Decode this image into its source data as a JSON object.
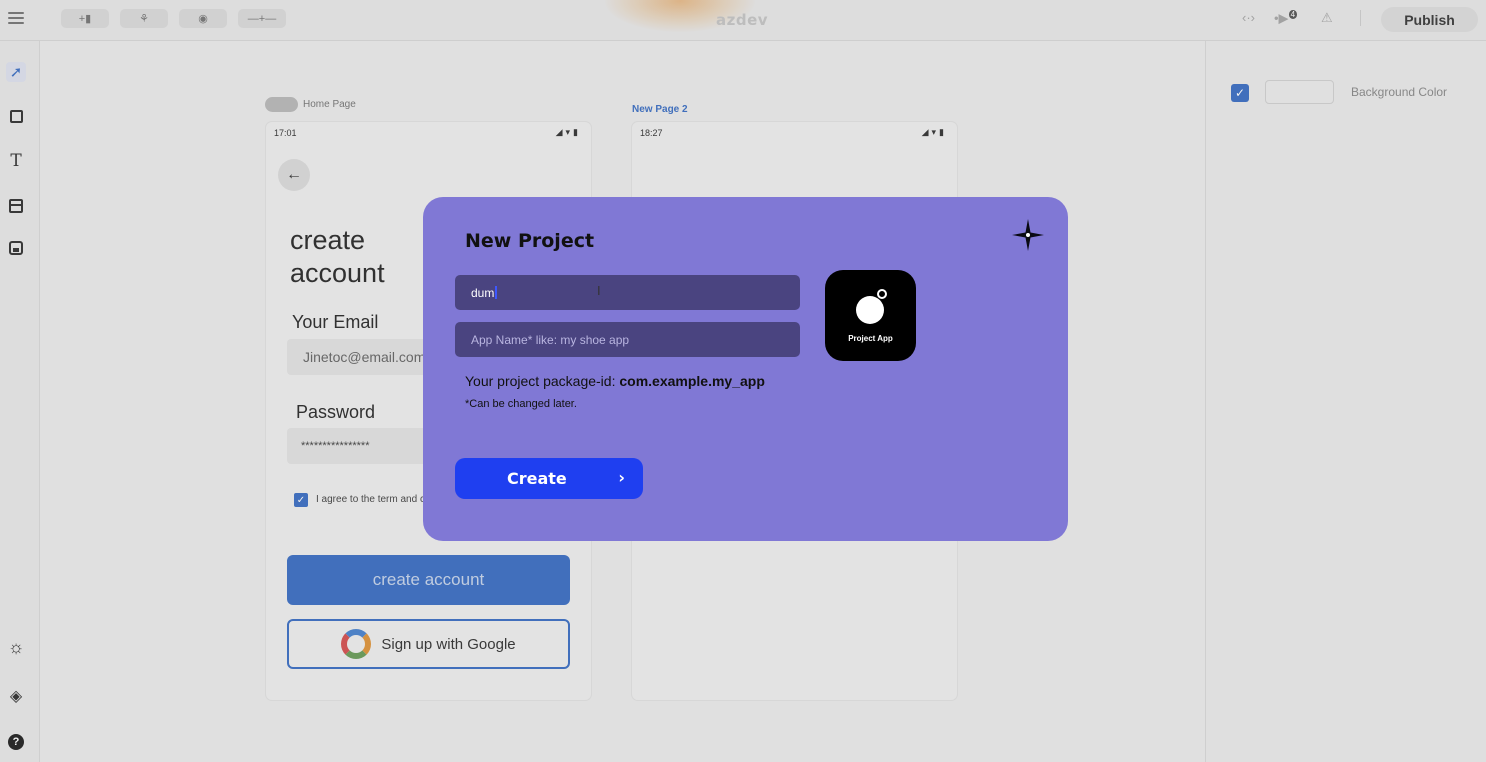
{
  "topbar": {
    "app_title": "azdev",
    "publish_label": "Publish",
    "buttons": [
      "+▮",
      "⚘",
      "◉",
      "—+—"
    ],
    "right_icons": [
      "code-icon",
      "play-icon",
      "warning-icon"
    ],
    "play_badge": "4"
  },
  "left_toolbar": {
    "tools": [
      "pointer-icon",
      "rectangle-icon",
      "text-icon",
      "layout-icon",
      "save-icon"
    ],
    "bottom": [
      "sun-icon",
      "layers-icon",
      "help-icon"
    ]
  },
  "right_panel": {
    "background_color_label": "Background Color",
    "background_enabled": true
  },
  "canvas": {
    "home_page": {
      "label": "Home Page",
      "status_time": "17:01",
      "title_line1": "create",
      "title_line2": "account",
      "email_label": "Your Email",
      "email_value": "Jinetoc@email.com",
      "password_label": "Password",
      "password_value": "****************",
      "agree_text": "I agree to the term and conditions",
      "create_account_label": "create account",
      "google_label": "Sign up with Google"
    },
    "page2": {
      "label": "New Page 2",
      "status_time": "18:27"
    }
  },
  "modal": {
    "title": "New Project",
    "project_name_value": "dum",
    "app_name_placeholder": "App Name* like: my shoe app",
    "package_prefix": "Your project package-id: ",
    "package_id": "com.example.my_app",
    "package_note": "*Can be changed later.",
    "app_icon_label": "Project App",
    "create_label": "Create"
  },
  "colors": {
    "modal_bg": "#8078d5",
    "input_bg": "#4a4480",
    "create_btn": "#1f3ff0",
    "accent_blue": "#3b6fc4"
  }
}
